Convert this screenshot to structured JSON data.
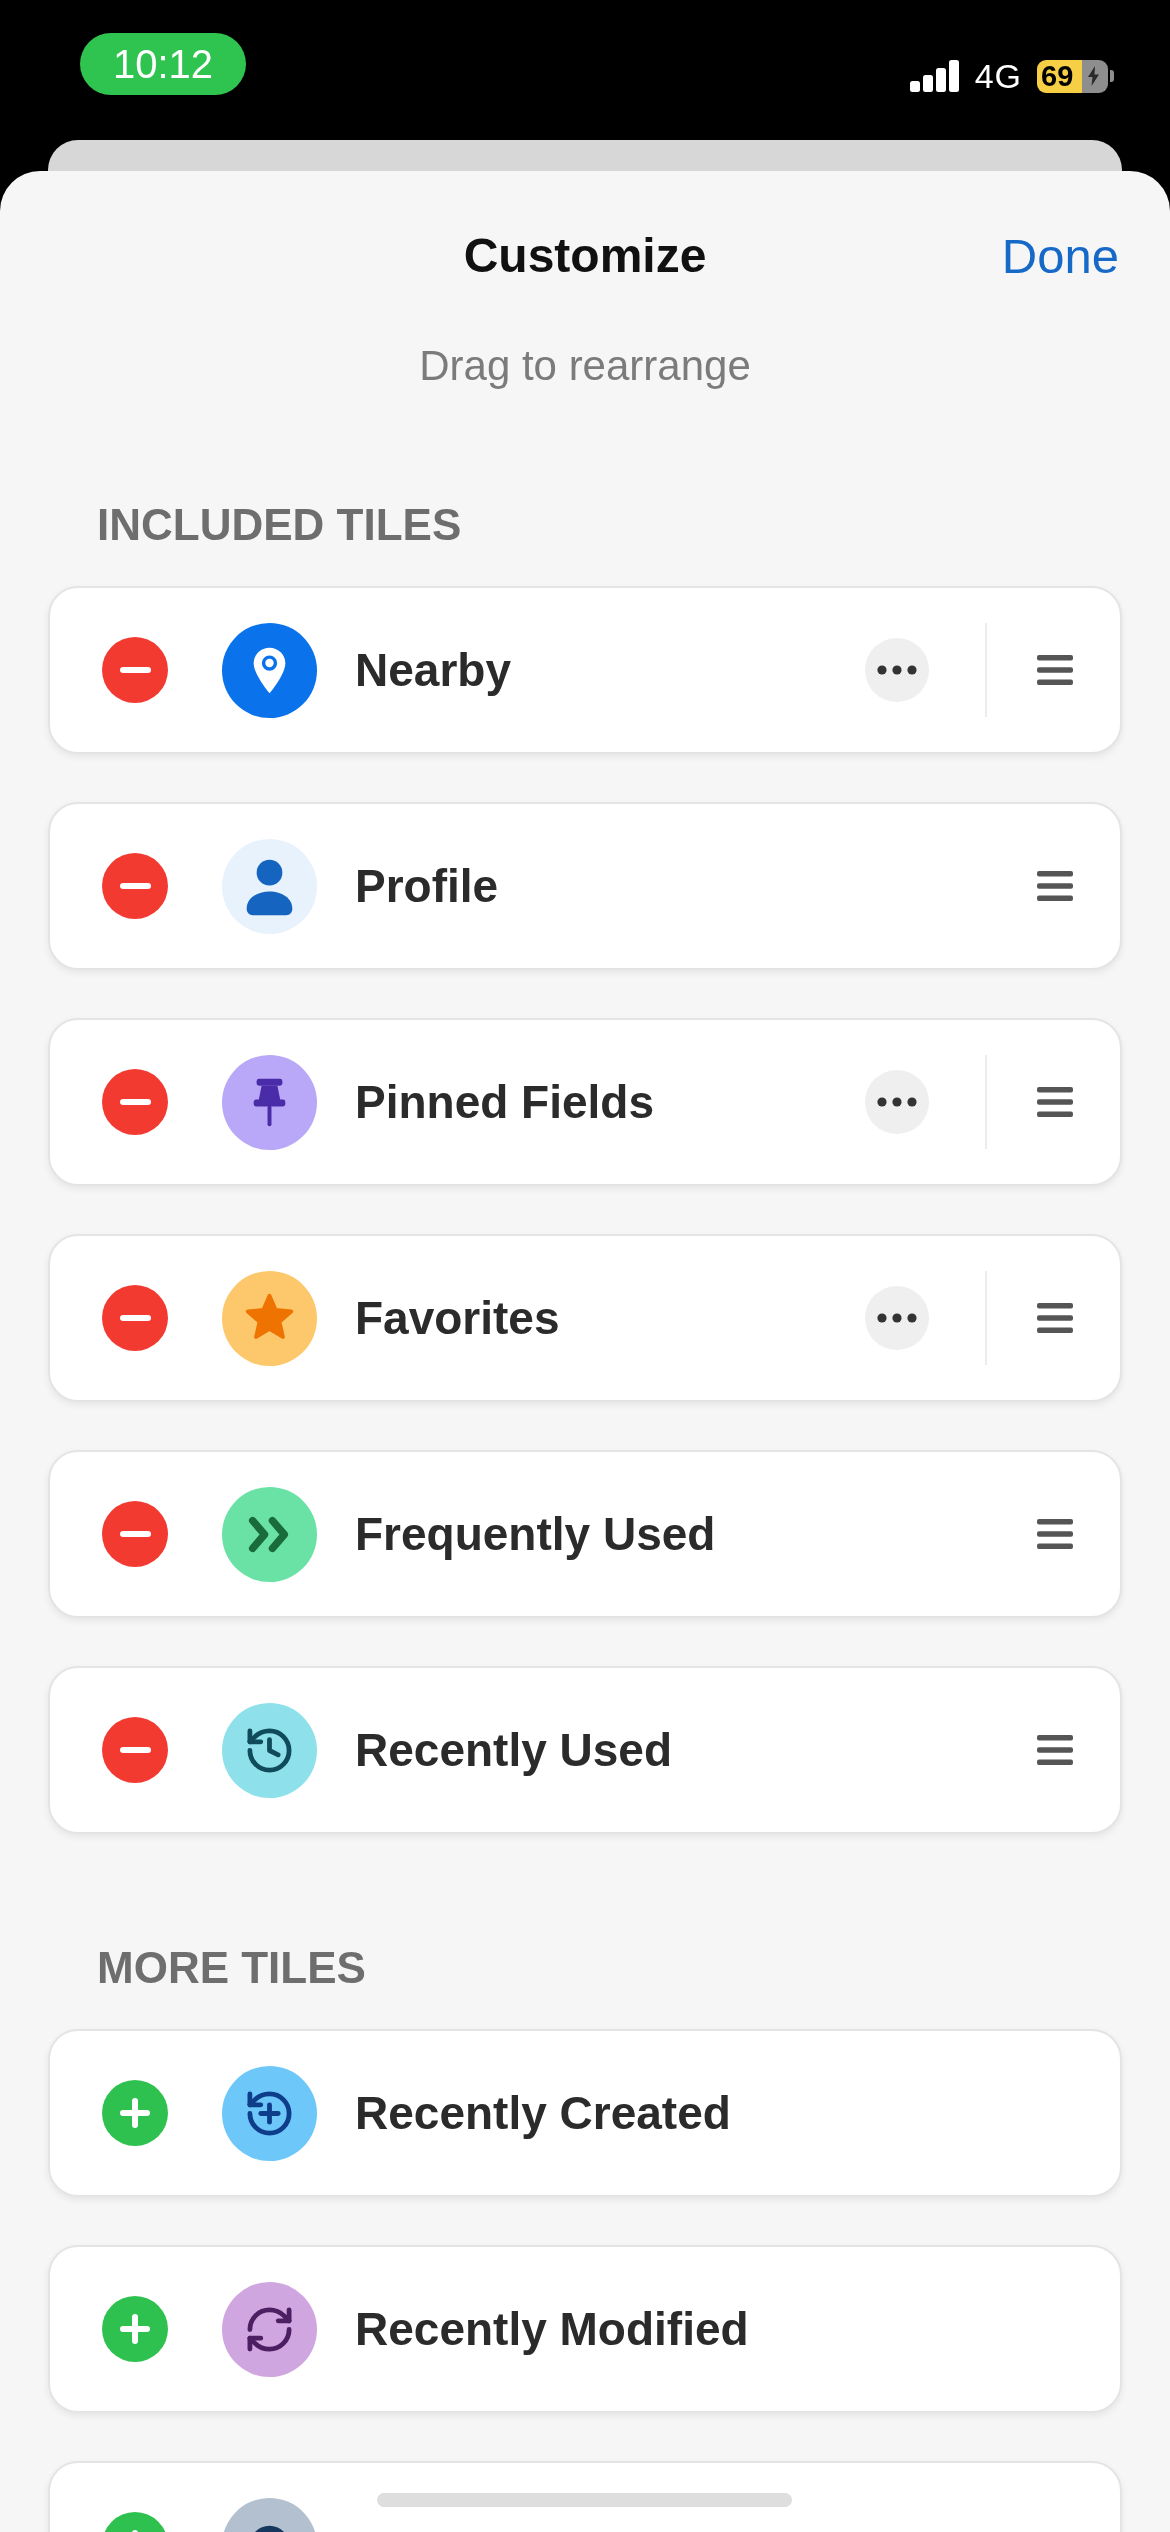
{
  "status_bar": {
    "time": "10:12",
    "network": "4G",
    "battery": "69"
  },
  "header": {
    "title": "Customize",
    "done": "Done",
    "subtitle": "Drag to rearrange"
  },
  "sections": [
    {
      "title": "INCLUDED TILES",
      "kind": "included",
      "tiles": [
        {
          "label": "Nearby",
          "color": "#0a72ea",
          "more": true
        },
        {
          "label": "Profile",
          "color": "#e8f2fd",
          "more": false
        },
        {
          "label": "Pinned Fields",
          "color": "#b8a8f7",
          "more": true
        },
        {
          "label": "Favorites",
          "color": "#fdc86b",
          "more": true
        },
        {
          "label": "Frequently Used",
          "color": "#6ae2a5",
          "more": false
        },
        {
          "label": "Recently Used",
          "color": "#8ee1eb",
          "more": false
        }
      ]
    },
    {
      "title": "MORE TILES",
      "kind": "available",
      "tiles": [
        {
          "label": "Recently Created",
          "color": "#6dc7f9",
          "more": false
        },
        {
          "label": "Recently Modified",
          "color": "#d0a6e0",
          "more": false
        },
        {
          "color": "#b3c0cf"
        }
      ]
    }
  ]
}
